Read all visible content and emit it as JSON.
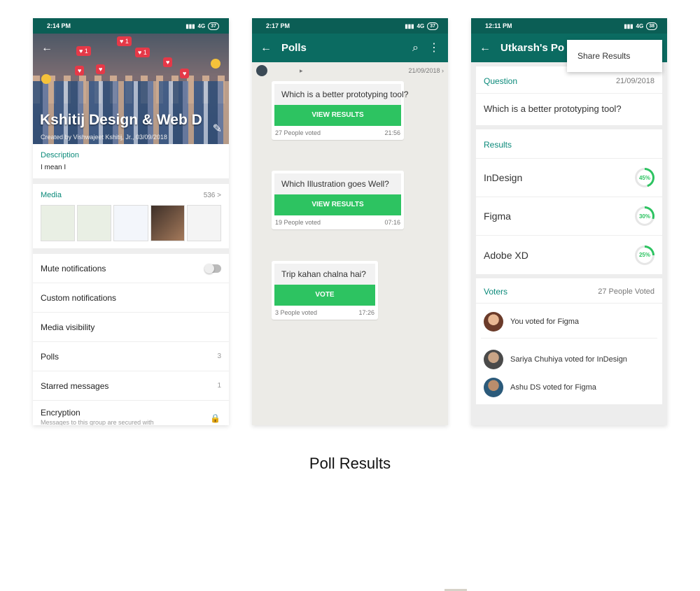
{
  "phone1": {
    "time": "2:14 PM",
    "signal": "4G",
    "battery": "37",
    "heart_count": "1",
    "group_name": "Kshitij Design & Web D",
    "created_by": "Created by Vishwajeet Kshitij, Jr., 03/09/2018",
    "description_label": "Description",
    "description_text": "I mean I",
    "media_label": "Media",
    "media_count": "536 >",
    "settings": [
      {
        "label": "Mute notifications"
      },
      {
        "label": "Custom notifications"
      },
      {
        "label": "Media visibility"
      },
      {
        "label": "Polls",
        "value": "3"
      },
      {
        "label": "Starred messages",
        "value": "1"
      }
    ],
    "encryption_label": "Encryption",
    "encryption_sub": "Messages to this group are secured with"
  },
  "phone2": {
    "time": "2:17 PM",
    "signal": "4G",
    "battery": "37",
    "title": "Polls",
    "chat_date": "21/09/2018",
    "polls": [
      {
        "question": "Which is a better prototyping tool?",
        "button": "VIEW RESULTS",
        "voted": "27 People voted",
        "time": "21:56"
      },
      {
        "question": "Which Illustration goes Well?",
        "button": "VIEW RESULTS",
        "voted": "19 People voted",
        "time": "07:16"
      },
      {
        "question": "Trip kahan chalna hai?",
        "button": "VOTE",
        "voted": "3 People voted",
        "time": "17:26"
      }
    ]
  },
  "phone3": {
    "time": "12:11 PM",
    "signal": "4G",
    "battery": "38",
    "title": "Utkarsh's Po",
    "menu_item": "Share Results",
    "question_label": "Question",
    "question_date": "21/09/2018",
    "question_text": "Which is a better prototyping tool?",
    "results_label": "Results",
    "results": [
      {
        "option": "InDesign",
        "percent": 45,
        "label": "45%"
      },
      {
        "option": "Figma",
        "percent": 30,
        "label": "30%"
      },
      {
        "option": "Adobe XD",
        "percent": 25,
        "label": "25%"
      }
    ],
    "voters_label": "Voters",
    "voters_count": "27 People Voted",
    "voters": [
      {
        "text": "You voted for Figma"
      },
      {
        "text": "Sariya Chuhiya voted for InDesign"
      },
      {
        "text": "Ashu DS voted for Figma"
      }
    ]
  },
  "caption": "Poll Results",
  "colors": {
    "teal_dark": "#0b5e55",
    "teal": "#0b6b61",
    "accent_green": "#2dc361",
    "heart_red": "#e53948"
  }
}
